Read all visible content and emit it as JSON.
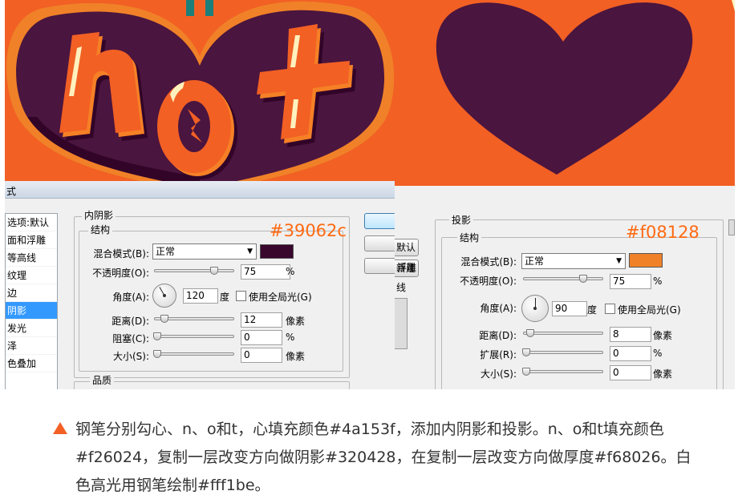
{
  "inner_shadow_panel": {
    "window_title_fragment": "式",
    "styles_list": [
      "选项:默认",
      "斜面和浮雕",
      "等高线",
      "纹理",
      "描边",
      "内阴影",
      "内发光",
      "光泽",
      "颜色叠加"
    ],
    "styles_list_visible": [
      "选项:默认",
      "面和浮雕",
      "等高线",
      "纹理",
      "边",
      "阴影",
      "发光",
      "泽",
      "色叠加"
    ],
    "selected_style": "阴影",
    "group_title": "内阴影",
    "subgroup_title": "结构",
    "blend_mode_label": "混合模式(B):",
    "blend_mode_value": "正常",
    "shadow_color": "#39062c",
    "color_annotation": "#39062c",
    "opacity_label": "不透明度(O):",
    "opacity_value": "75",
    "opacity_unit": "%",
    "opacity_percent": 75,
    "angle_label": "角度(A):",
    "angle_value": "120",
    "angle_unit": "度",
    "global_light_label": "使用全局光(G)",
    "global_light_checked": false,
    "distance_label": "距离(D):",
    "distance_value": "12",
    "distance_unit": "像素",
    "choke_label": "阻塞(C):",
    "choke_value": "0",
    "choke_unit": "%",
    "size_label": "大小(S):",
    "size_value": "0",
    "size_unit": "像素",
    "quality_label": "品质"
  },
  "middle_buttons": {
    "reset_fragment": "默认",
    "new_style": "新建",
    "bevel_fragment": "浮雕",
    "line_fragment": "线",
    "preview_checked": true
  },
  "drop_shadow_panel": {
    "group_title": "投影",
    "subgroup_title": "结构",
    "blend_mode_label": "混合模式(B):",
    "blend_mode_value": "正常",
    "shadow_color": "#f08128",
    "color_annotation": "#f08128",
    "opacity_label": "不透明度(O):",
    "opacity_value": "75",
    "opacity_unit": "%",
    "opacity_percent": 75,
    "angle_label": "角度(A):",
    "angle_value": "90",
    "angle_unit": "度",
    "global_light_label": "使用全局光(G)",
    "global_light_checked": false,
    "distance_label": "距离(D):",
    "distance_value": "8",
    "distance_unit": "像素",
    "spread_label": "扩展(R):",
    "spread_value": "0",
    "spread_unit": "%",
    "size_label": "大小(S):",
    "size_value": "0",
    "size_unit": "像素"
  },
  "artwork_colors": {
    "background": "#f26024",
    "heart": "#4a153f",
    "heart_shadow": "#320428",
    "letter_face": "#f26024",
    "letter_thickness": "#f68026",
    "highlight": "#fff1be",
    "rim": "#f08128"
  },
  "caption": {
    "marker_color": "#f26024",
    "text": "钢笔分别勾心、n、o和t，心填充颜色#4a153f，添加内阴影和投影。n、o和t填充颜色#f26024，复制一层改变方向做阴影#320428，在复制一层改变方向做厚度#f68026。白色高光用钢笔绘制#fff1be。"
  }
}
